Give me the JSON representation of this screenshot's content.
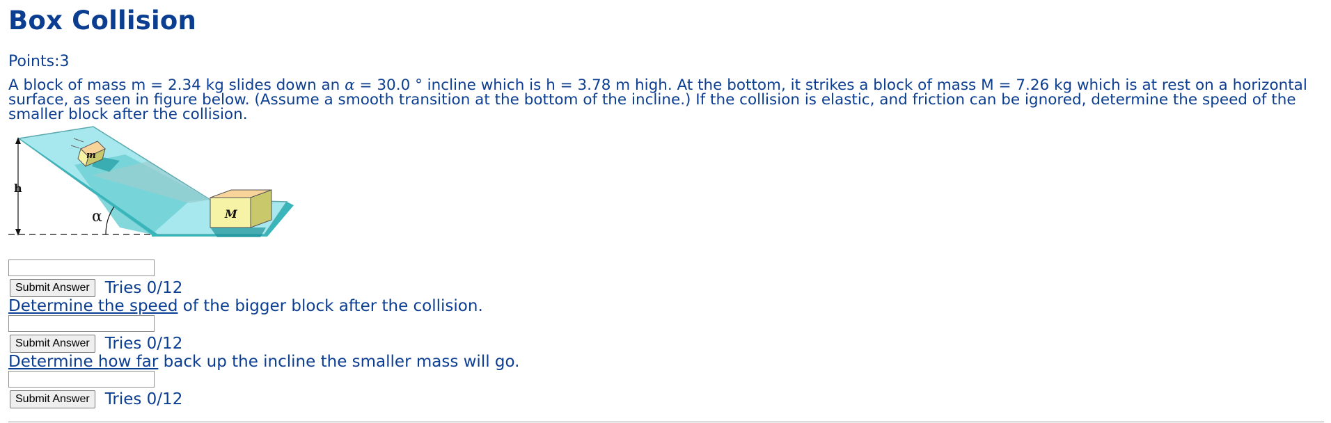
{
  "title": "Box Collision",
  "points_label": "Points:3",
  "problem": {
    "part1": "A block of mass m = 2.34 kg slides down an ",
    "alpha_symbol": "α",
    "part2": " = 30.0 ° incline which is h = 3.78 m high. At the bottom, it strikes a block of mass M = 7.26 kg which is at rest on a horizontal surface, as seen in figure below. (Assume a smooth transition at the bottom of the incline.) If the collision is elastic, and friction can be ignored, determine the speed of the smaller block after the collision."
  },
  "figure": {
    "label_h": "h",
    "label_alpha": "α",
    "label_small_block": "m",
    "label_big_block": "M",
    "colors": {
      "ramp_light": "#a7e8ee",
      "ramp_mid": "#6fd1d6",
      "ramp_dark": "#3ab6bb",
      "block_face": "#f6f3a6",
      "block_side": "#c9c86a",
      "block_top": "#f9d49a"
    }
  },
  "questions": [
    {
      "text": "",
      "submit_label": "Submit Answer",
      "tries": "Tries 0/12"
    },
    {
      "link_text": "Determine the speed",
      "text": " of the bigger block after the collision.",
      "submit_label": "Submit Answer",
      "tries": "Tries 0/12"
    },
    {
      "link_text": "Determine how far",
      "text": " back up the incline the smaller mass will go.",
      "submit_label": "Submit Answer",
      "tries": "Tries 0/12"
    }
  ]
}
